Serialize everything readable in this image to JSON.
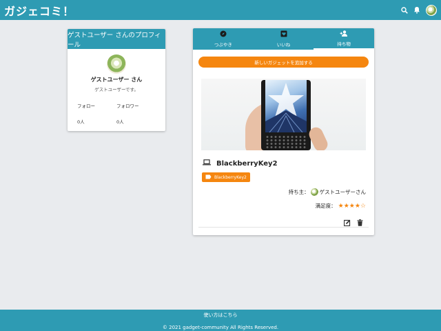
{
  "appbar": {
    "brand": "ガジェコミ！",
    "icons": [
      "search-icon",
      "bell-icon",
      "avatar"
    ]
  },
  "profile": {
    "header": "ゲストユーザー さんのプロフィール",
    "name": "ゲストユーザー さん",
    "description": "ゲストユーザーです。",
    "follow_label": "フォロー",
    "follow_count": "0人",
    "follower_label": "フォロワー",
    "follower_count": "0人"
  },
  "tabs": [
    {
      "label": "つぶやき",
      "icon": "compass-icon"
    },
    {
      "label": "いいね",
      "icon": "heart-box-icon"
    },
    {
      "label": "持ち物",
      "icon": "person-add-icon",
      "active": true
    }
  ],
  "add_button": "新しいガジェットを追加する",
  "gadget": {
    "title": "BlackberryKey2",
    "tag": "BlackberryKey2",
    "owner_label": "持ち主：",
    "owner_name": "ゲストユーザーさん",
    "rating_label": "満足度：",
    "rating": 4,
    "rating_max": 5
  },
  "footer": {
    "link": "使い方はこちら",
    "copyright": "© 2021 gadget-community All Rights Reserved."
  },
  "colors": {
    "primary": "#2e9bb3",
    "accent": "#f5860f",
    "background": "#e9ebee"
  }
}
